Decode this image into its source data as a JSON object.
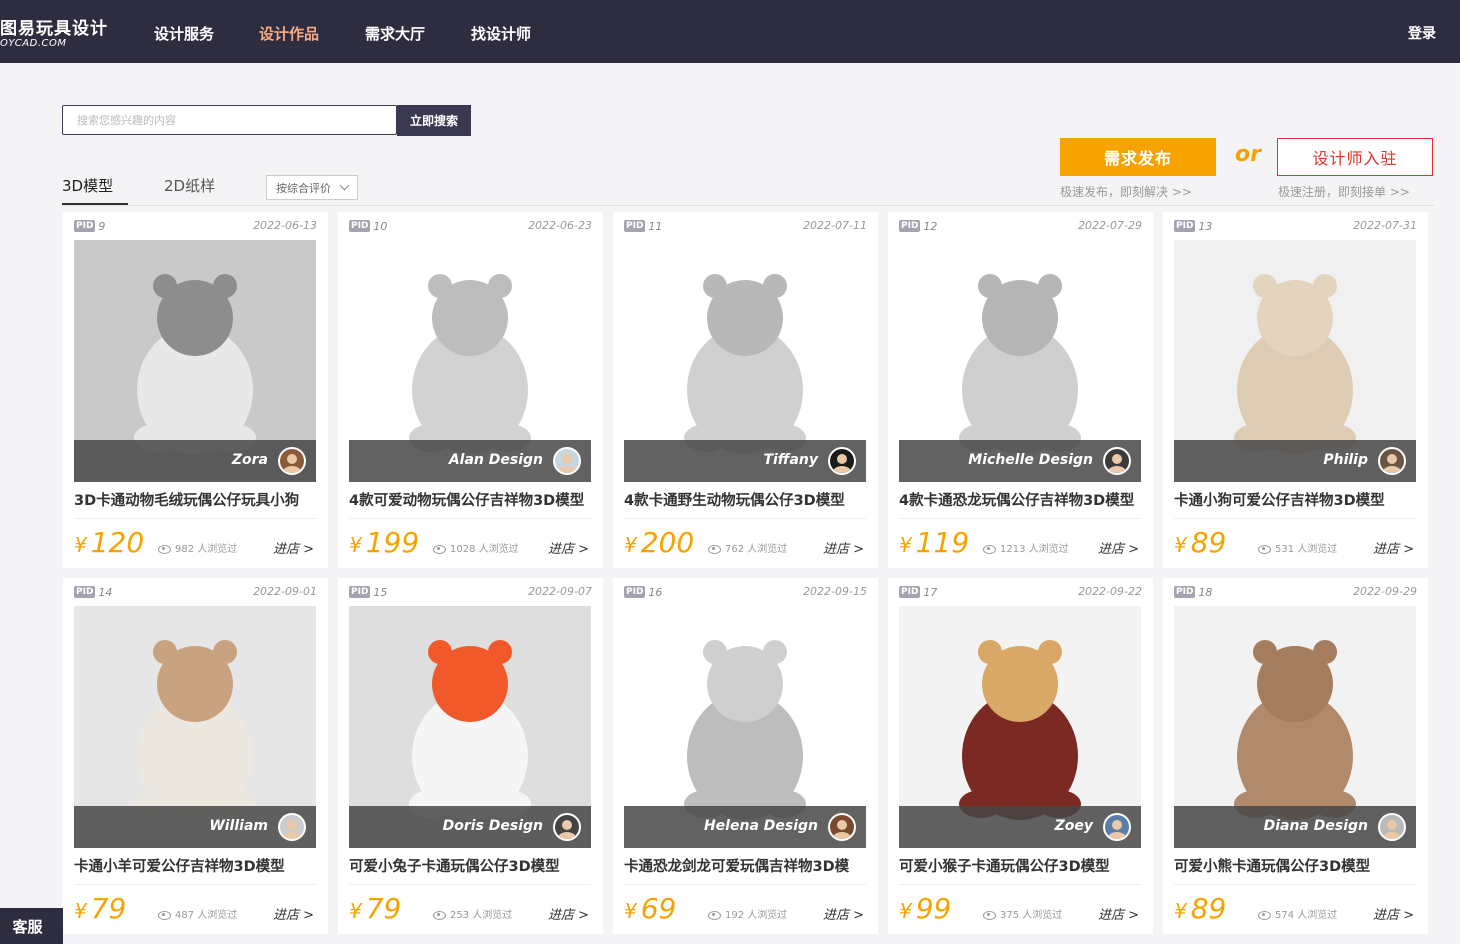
{
  "nav": {
    "logo": "图易玩具设计",
    "logo_sub": "OYCAD.COM",
    "items": [
      "设计服务",
      "设计作品",
      "需求大厅",
      "找设计师"
    ],
    "active_index": 1,
    "login": "登录"
  },
  "search": {
    "placeholder": "搜索您感兴趣的内容",
    "button": "立即搜索"
  },
  "actions": {
    "publish": "需求发布",
    "or": "or",
    "join": "设计师入驻",
    "publish_hint": "极速发布，即刻解决 >>",
    "join_hint": "极速注册，即刻接单 >>"
  },
  "tabs": [
    "3D模型",
    "2D纸样"
  ],
  "sort_label": "按综合评价",
  "card_labels": {
    "pid": "PID",
    "currency": "¥",
    "views_suffix": "人浏览过",
    "enter": "进店 >"
  },
  "products": [
    {
      "pid": "9",
      "date": "2022-06-13",
      "designer": "Zora",
      "title": "3D卡通动物毛绒玩偶公仔玩具小狗",
      "price": "120",
      "views": "982 人浏览过"
    },
    {
      "pid": "10",
      "date": "2022-06-23",
      "designer": "Alan Design",
      "title": "4款可爱动物玩偶公仔吉祥物3D模型",
      "price": "199",
      "views": "1028 人浏览过"
    },
    {
      "pid": "11",
      "date": "2022-07-11",
      "designer": "Tiffany",
      "title": "4款卡通野生动物玩偶公仔3D模型",
      "price": "200",
      "views": "762 人浏览过"
    },
    {
      "pid": "12",
      "date": "2022-07-29",
      "designer": "Michelle Design",
      "title": "4款卡通恐龙玩偶公仔吉祥物3D模型",
      "price": "119",
      "views": "1213 人浏览过"
    },
    {
      "pid": "13",
      "date": "2022-07-31",
      "designer": "Philip",
      "title": "卡通小狗可爱公仔吉祥物3D模型",
      "price": "89",
      "views": "531 人浏览过"
    },
    {
      "pid": "14",
      "date": "2022-09-01",
      "designer": "William",
      "title": "卡通小羊可爱公仔吉祥物3D模型",
      "price": "79",
      "views": "487 人浏览过"
    },
    {
      "pid": "15",
      "date": "2022-09-07",
      "designer": "Doris Design",
      "title": "可爱小兔子卡通玩偶公仔3D模型",
      "price": "79",
      "views": "253 人浏览过"
    },
    {
      "pid": "16",
      "date": "2022-09-15",
      "designer": "Helena Design",
      "title": "卡通恐龙剑龙可爱玩偶吉祥物3D模",
      "price": "69",
      "views": "192 人浏览过"
    },
    {
      "pid": "17",
      "date": "2022-09-22",
      "designer": "Zoey",
      "title": "可爱小猴子卡通玩偶公仔3D模型",
      "price": "99",
      "views": "375 人浏览过"
    },
    {
      "pid": "18",
      "date": "2022-09-29",
      "designer": "Diana Design",
      "title": "可爱小熊卡通玩偶公仔3D模型",
      "price": "89",
      "views": "574 人浏览过"
    }
  ],
  "kefu": "客服"
}
